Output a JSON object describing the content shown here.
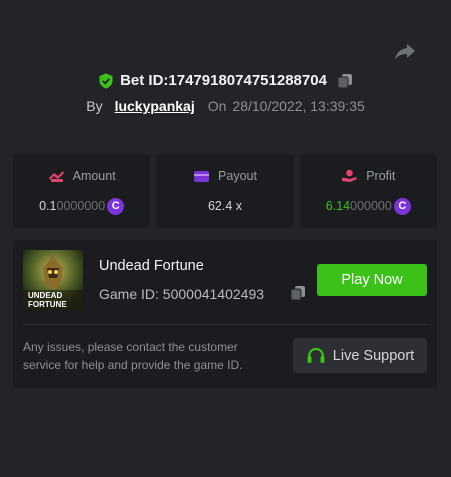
{
  "header": {
    "bet_label": "Bet ID: ",
    "bet_id": "1747918074751288704",
    "by_label": "By",
    "username": "luckypankaj",
    "on_label": "On",
    "date": "28/10/2022, 13:39:35"
  },
  "stats": {
    "amount": {
      "label": "Amount",
      "value_bright": "0.1",
      "value_dim": "0000000"
    },
    "payout": {
      "label": "Payout",
      "value": "62.4 x"
    },
    "profit": {
      "label": "Profit",
      "value_bright": "6.14",
      "value_dim": "000000"
    }
  },
  "game": {
    "name": "Undead Fortune",
    "id_label": "Game ID: ",
    "id": "5000041402493",
    "thumbnail_text_line1": "UNDEAD",
    "thumbnail_text_line2": "FORTUNE",
    "play_label": "Play Now"
  },
  "support": {
    "note": "Any issues, please contact the customer service for help and provide the game ID.",
    "button_label": "Live Support"
  },
  "colors": {
    "background": "#232428",
    "card": "#1b1c1f",
    "accent_green": "#3bc117",
    "coin_purple": "#7b34d9",
    "amount_icon": "#e5436b",
    "payout_icon": "#7b34d9",
    "profit_icon": "#e5436b"
  },
  "icons": {
    "share": "share-icon",
    "verified": "shield-check-icon",
    "copy": "copy-icon",
    "amount": "bet-chips-icon",
    "payout": "wallet-icon",
    "profit": "coin-hand-icon",
    "coin": "coin-icon",
    "support": "headset-icon"
  }
}
